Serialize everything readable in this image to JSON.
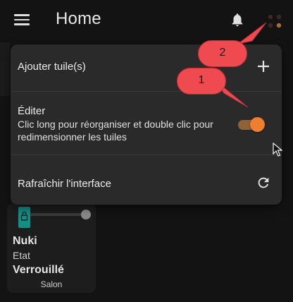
{
  "header": {
    "title": "Home",
    "icons": {
      "menu": "hamburger-menu-icon",
      "bell": "bell-icon",
      "more": "dots-menu-icon"
    }
  },
  "menu": {
    "items": [
      {
        "label": "Ajouter tuile(s)",
        "icon": "plus-icon"
      },
      {
        "label": "Éditer",
        "description": "Clic long pour réorganiser et double clic pour redimensionner les tuiles",
        "toggle_on": true
      },
      {
        "label": "Rafraîchir l'interface",
        "icon": "refresh-icon"
      }
    ]
  },
  "tile": {
    "name": "Nuki",
    "state_label": "Etat",
    "state": "Verrouillé",
    "room": "Salon",
    "icon": "lock-icon"
  },
  "callouts": [
    "1",
    "2"
  ],
  "colors": {
    "background": "#131313",
    "menu_bg": "#2a2a2a",
    "accent_orange": "#ef7e2e",
    "callout_red": "#f04a51",
    "tile_icon_teal": "#138f84"
  }
}
